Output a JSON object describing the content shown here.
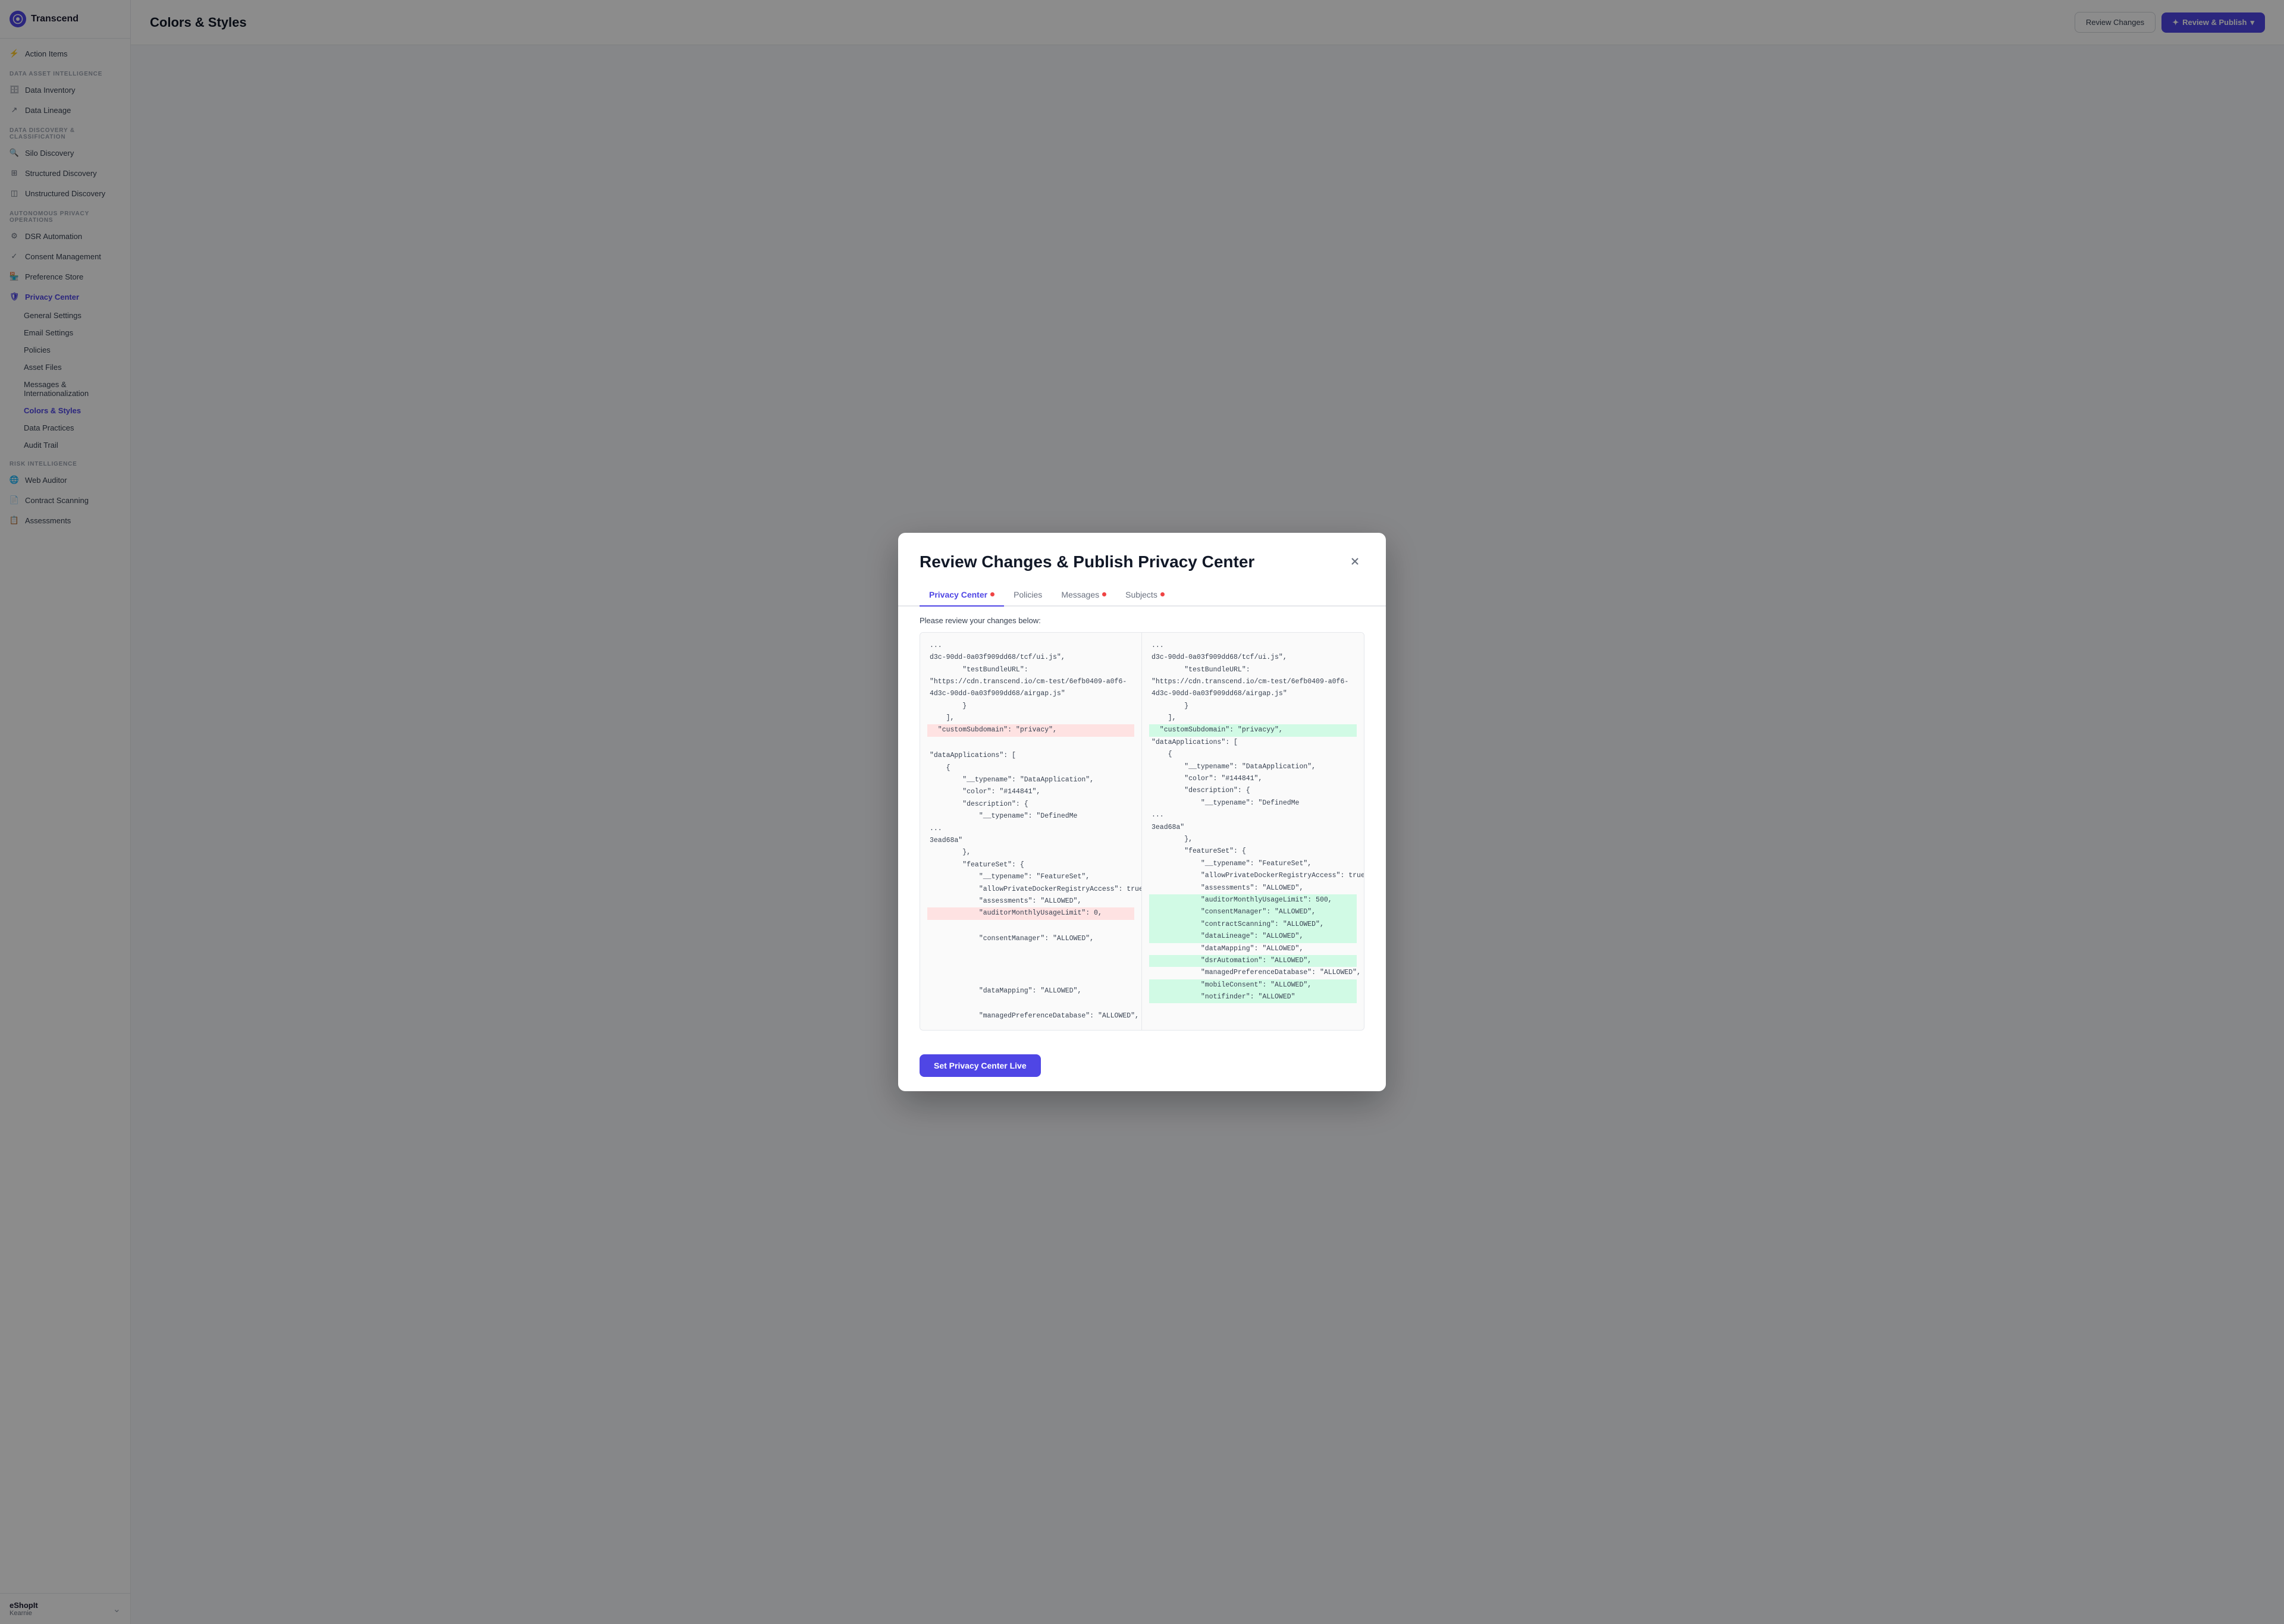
{
  "app": {
    "name": "Transcend"
  },
  "sidebar": {
    "logo": "T",
    "action_items_label": "Action Items",
    "sections": [
      {
        "label": "DATA ASSET INTELLIGENCE",
        "items": [
          {
            "id": "data-inventory",
            "label": "Data Inventory",
            "icon": "db"
          },
          {
            "id": "data-lineage",
            "label": "Data Lineage",
            "icon": "flow"
          }
        ]
      },
      {
        "label": "DATA DISCOVERY & CLASSIFICATION",
        "items": [
          {
            "id": "silo-discovery",
            "label": "Silo Discovery",
            "icon": "search"
          },
          {
            "id": "structured-discovery",
            "label": "Structured Discovery",
            "icon": "grid"
          },
          {
            "id": "unstructured-discovery",
            "label": "Unstructured Discovery",
            "icon": "layers"
          }
        ]
      },
      {
        "label": "AUTONOMOUS PRIVACY OPERATIONS",
        "items": [
          {
            "id": "dsr-automation",
            "label": "DSR Automation",
            "icon": "auto"
          },
          {
            "id": "consent-management",
            "label": "Consent Management",
            "icon": "check"
          },
          {
            "id": "preference-store",
            "label": "Preference Store",
            "icon": "store"
          },
          {
            "id": "privacy-center",
            "label": "Privacy Center",
            "icon": "shield",
            "active": true
          }
        ]
      }
    ],
    "privacy_center_subitems": [
      {
        "id": "general-settings",
        "label": "General Settings"
      },
      {
        "id": "email-settings",
        "label": "Email Settings"
      },
      {
        "id": "policies",
        "label": "Policies"
      },
      {
        "id": "asset-files",
        "label": "Asset Files"
      },
      {
        "id": "messages-i18n",
        "label": "Messages & Internationalization"
      },
      {
        "id": "colors-styles",
        "label": "Colors & Styles",
        "active": true
      },
      {
        "id": "data-practices",
        "label": "Data Practices"
      },
      {
        "id": "audit-trail",
        "label": "Audit Trail"
      }
    ],
    "risk_section_label": "RISK INTELLIGENCE",
    "risk_items": [
      {
        "id": "web-auditor",
        "label": "Web Auditor",
        "icon": "globe"
      },
      {
        "id": "contract-scanning",
        "label": "Contract Scanning",
        "icon": "doc"
      },
      {
        "id": "assessments",
        "label": "Assessments",
        "icon": "clipboard"
      }
    ],
    "footer": {
      "name": "eShopIt",
      "sub": "Kearnie"
    }
  },
  "modal": {
    "title": "Review Changes & Publish Privacy Center",
    "close_label": "×",
    "tabs": [
      {
        "id": "privacy-center",
        "label": "Privacy Center",
        "active": true,
        "dot": true
      },
      {
        "id": "policies",
        "label": "Policies",
        "active": false,
        "dot": false
      },
      {
        "id": "messages",
        "label": "Messages",
        "active": false,
        "dot": true
      },
      {
        "id": "subjects",
        "label": "Subjects",
        "active": false,
        "dot": true
      }
    ],
    "review_note": "Please review your changes below:",
    "diff": {
      "left_lines": [
        "...",
        "d3c-90dd-0a03f909dd68/tcf/ui.js\",",
        "        \"testBundleURL\":",
        "\"https://cdn.transcend.io/cm-test/6efb0409-a0f6-",
        "4d3c-90dd-0a03f909dd68/airgap.js\"",
        "        }",
        "    ],",
        "  \"customSubdomain\": \"privacy\",",
        "",
        "\"dataApplications\": [",
        "    {",
        "        \"__typename\": \"DataApplication\",",
        "        \"color\": \"#144841\",",
        "        \"description\": {",
        "            \"__typename\": \"DefinedMe",
        "...",
        "3ead68a\"",
        "        },",
        "        \"featureSet\": {",
        "            \"__typename\": \"FeatureSet\",",
        "            \"allowPrivateDockerRegistryAccess\": true,",
        "            \"assessments\": \"ALLOWED\",",
        "            \"auditorMonthlyUsageLimit\": 0,",
        "",
        "            \"consentManager\": \"ALLOWED\",",
        "",
        "",
        "",
        "            \"dataMapping\": \"ALLOWED\",",
        "",
        "            \"managedPreferenceDatabase\": \"ALLOWED\","
      ],
      "right_lines": [
        "...",
        "d3c-90dd-0a03f909dd68/tcf/ui.js\",",
        "        \"testBundleURL\":",
        "\"https://cdn.transcend.io/cm-test/6efb0409-a0f6-",
        "4d3c-90dd-0a03f909dd68/airgap.js\"",
        "        }",
        "    ],",
        "  \"customSubdomain\": \"privacyy\",",
        "\"dataApplications\": [",
        "    {",
        "        \"__typename\": \"DataApplication\",",
        "        \"color\": \"#144841\",",
        "        \"description\": {",
        "            \"__typename\": \"DefinedMe",
        "...",
        "3ead68a\"",
        "        },",
        "        \"featureSet\": {",
        "            \"__typename\": \"FeatureSet\",",
        "            \"allowPrivateDockerRegistryAccess\": true,",
        "            \"assessments\": \"ALLOWED\",",
        "            \"auditorMonthlyUsageLimit\": 500,",
        "            \"consentManager\": \"ALLOWED\",",
        "            \"contractScanning\": \"ALLOWED\",",
        "            \"dataLineage\": \"ALLOWED\",",
        "            \"dataMapping\": \"ALLOWED\",",
        "            \"dsrAutomation\": \"ALLOWED\",",
        "            \"managedPreferenceDatabase\": \"ALLOWED\",",
        "            \"mobileConsent\": \"ALLOWED\",",
        "            \"notifinder\": \"ALLOWED\""
      ]
    },
    "publish_button_label": "Set Privacy Center Live"
  },
  "header": {
    "review_changes_label": "Review Changes",
    "publish_label": "Review & Publish"
  }
}
